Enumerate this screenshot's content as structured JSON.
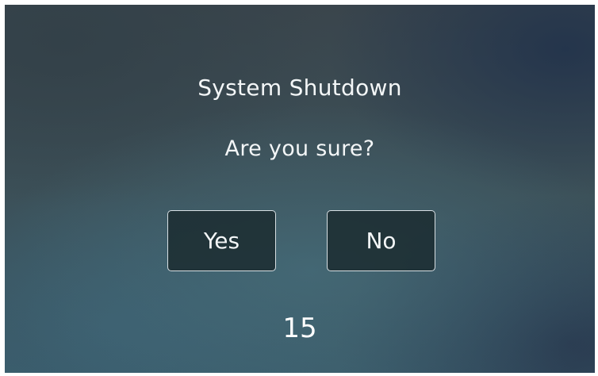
{
  "dialog": {
    "title": "System Shutdown",
    "question": "Are you sure?",
    "yes_label": "Yes",
    "no_label": "No",
    "countdown": "15"
  },
  "colors": {
    "background_dark": "#3a454c",
    "background_teal": "#3a5a68",
    "button_fill": "#1d2d32",
    "button_border": "#d7dfe3",
    "text": "#f3f6f7"
  }
}
